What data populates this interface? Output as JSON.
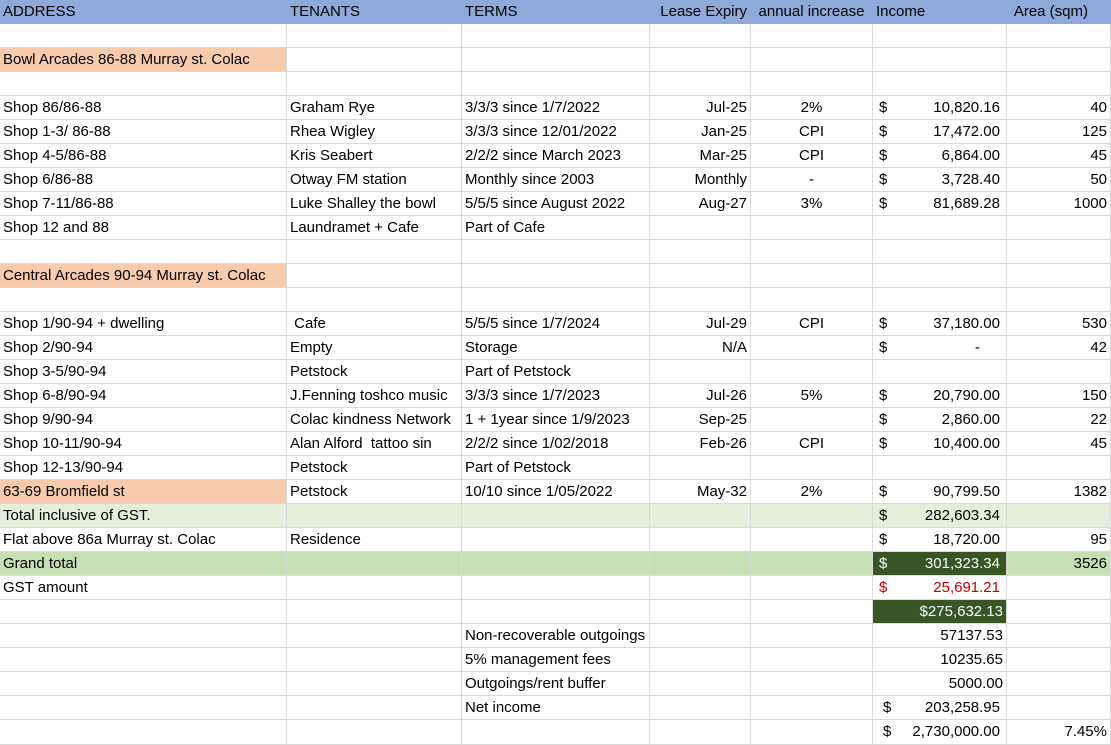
{
  "header": [
    "ADDRESS",
    "TENANTS",
    "TERMS",
    "Lease Expiry",
    "annual increase",
    "Income",
    "Area (sqm)"
  ],
  "section1": "Bowl Arcades 86-88 Murray st. Colac",
  "rows1": [
    {
      "address": "Shop 86/86-88",
      "tenant": "Graham Rye",
      "terms": "3/3/3 since 1/7/2022",
      "expiry": "Jul-25",
      "increase": "2%",
      "currency": "$",
      "income": "10,820.16",
      "area": "40"
    },
    {
      "address": "Shop 1-3/ 86-88",
      "tenant": "Rhea Wigley",
      "terms": "3/3/3 since 12/01/2022",
      "expiry": "Jan-25",
      "increase": "CPI",
      "currency": "$",
      "income": "17,472.00",
      "area": "125"
    },
    {
      "address": "Shop 4-5/86-88",
      "tenant": "Kris Seabert",
      "terms": "2/2/2 since March 2023",
      "expiry": "Mar-25",
      "increase": "CPI",
      "currency": "$",
      "income": "6,864.00",
      "area": "45"
    },
    {
      "address": "Shop 6/86-88",
      "tenant": "Otway FM station",
      "terms": "Monthly since 2003",
      "expiry": "Monthly",
      "increase": "-",
      "currency": "$",
      "income": "3,728.40",
      "area": "50"
    },
    {
      "address": "Shop 7-11/86-88",
      "tenant": "Luke Shalley the bowl",
      "terms": "5/5/5 since August 2022",
      "expiry": "Aug-27",
      "increase": "3%",
      "currency": "$",
      "income": "81,689.28",
      "area": "1000"
    },
    {
      "address": "Shop 12 and 88",
      "tenant": "Laundramet + Cafe",
      "terms": "Part of Cafe",
      "expiry": "",
      "increase": "",
      "currency": "",
      "income": "",
      "area": ""
    }
  ],
  "section2": "Central Arcades 90-94 Murray st. Colac",
  "rows2": [
    {
      "address": "Shop 1/90-94 + dwelling",
      "tenant": " Cafe",
      "terms": "5/5/5 since 1/7/2024",
      "expiry": "Jul-29",
      "increase": "CPI",
      "currency": "$",
      "income": "37,180.00",
      "area": "530"
    },
    {
      "address": "Shop 2/90-94",
      "tenant": "Empty",
      "terms": "Storage",
      "expiry": "N/A",
      "increase": "",
      "currency": "$",
      "income": "-",
      "area": "42"
    },
    {
      "address": "Shop 3-5/90-94",
      "tenant": "Petstock",
      "terms": "Part of Petstock",
      "expiry": "",
      "increase": "",
      "currency": "",
      "income": "",
      "area": ""
    },
    {
      "address": "Shop 6-8/90-94",
      "tenant": "J.Fenning toshco music",
      "terms": "3/3/3 since 1/7/2023",
      "expiry": "Jul-26",
      "increase": "5%",
      "currency": "$",
      "income": "20,790.00",
      "area": "150"
    },
    {
      "address": "Shop 9/90-94",
      "tenant": "Colac kindness Network",
      "terms": "1 + 1year since 1/9/2023",
      "expiry": "Sep-25",
      "increase": "",
      "currency": "$",
      "income": "2,860.00",
      "area": "22"
    },
    {
      "address": "Shop 10-11/90-94",
      "tenant": "Alan Alford  tattoo sin",
      "terms": "2/2/2 since 1/02/2018",
      "expiry": "Feb-26",
      "increase": "CPI",
      "currency": "$",
      "income": "10,400.00",
      "area": "45"
    },
    {
      "address": "Shop 12-13/90-94",
      "tenant": "Petstock",
      "terms": "Part of Petstock",
      "expiry": "",
      "increase": "",
      "currency": "",
      "income": "",
      "area": ""
    }
  ],
  "bromfield": {
    "address": "63-69 Bromfield st",
    "tenant": "Petstock",
    "terms": "10/10 since 1/05/2022",
    "expiry": "May-32",
    "increase": "2%",
    "currency": "$",
    "income": "90,799.50",
    "area": "1382"
  },
  "total_gst": {
    "label": "Total inclusive of GST.",
    "currency": "$",
    "income": "282,603.34"
  },
  "flat": {
    "address": "Flat above  86a Murray st. Colac",
    "tenant": "Residence",
    "currency": "$",
    "income": "18,720.00",
    "area": "95"
  },
  "grand_total": {
    "label": "Grand total",
    "currency": "$",
    "income": "301,323.34",
    "area": "3526"
  },
  "gst_amount": {
    "label": "GST amount",
    "currency": "$",
    "income": "25,691.21"
  },
  "ex_gst_total": "$275,632.13",
  "outgoings": [
    {
      "label": "Non-recoverable outgoings",
      "value": "57137.53"
    },
    {
      "label": "5% management fees",
      "value": "10235.65"
    },
    {
      "label": "Outgoings/rent buffer",
      "value": "5000.00"
    }
  ],
  "net_income": {
    "label": "Net income",
    "currency": "$",
    "value": "203,258.95"
  },
  "property_value": {
    "currency": "$",
    "value": "2,730,000.00",
    "yield": "7.45%"
  },
  "colors": {
    "header": "#8eaadb",
    "section": "#f8cbad",
    "total": "#e2efda",
    "grand_total": "#c6e0b4",
    "gst_red": "#c00000",
    "dark_total": "#375623"
  }
}
